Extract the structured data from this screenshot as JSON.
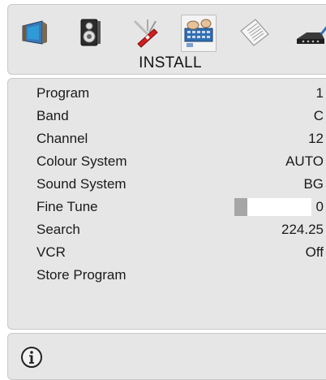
{
  "header": {
    "title": "INSTALL",
    "tabs": [
      {
        "name": "picture-tab",
        "icon": "picture-icon",
        "active": false
      },
      {
        "name": "sound-tab",
        "icon": "speaker-icon",
        "active": false
      },
      {
        "name": "features-tab",
        "icon": "swiss-knife-icon",
        "active": false
      },
      {
        "name": "install-tab",
        "icon": "install-icon",
        "active": true
      },
      {
        "name": "guide-tab",
        "icon": "document-icon",
        "active": false
      },
      {
        "name": "connection-tab",
        "icon": "connector-icon",
        "active": false
      }
    ]
  },
  "menu": {
    "items": [
      {
        "label": "Program",
        "value": "1"
      },
      {
        "label": "Band",
        "value": "C"
      },
      {
        "label": "Channel",
        "value": "12"
      },
      {
        "label": "Colour System",
        "value": "AUTO"
      },
      {
        "label": "Sound System",
        "value": "BG"
      },
      {
        "label": "Fine Tune",
        "value": "0",
        "bar_level": 0.17
      },
      {
        "label": "Search",
        "value": "224.25"
      },
      {
        "label": "VCR",
        "value": "Off"
      },
      {
        "label": "Store Program",
        "value": ""
      }
    ]
  },
  "info": {
    "icon": "info-icon"
  },
  "colors": {
    "panel": "#e6e6e6",
    "bar_fill": "#a6a6a6",
    "bar_track": "#ffffff"
  }
}
